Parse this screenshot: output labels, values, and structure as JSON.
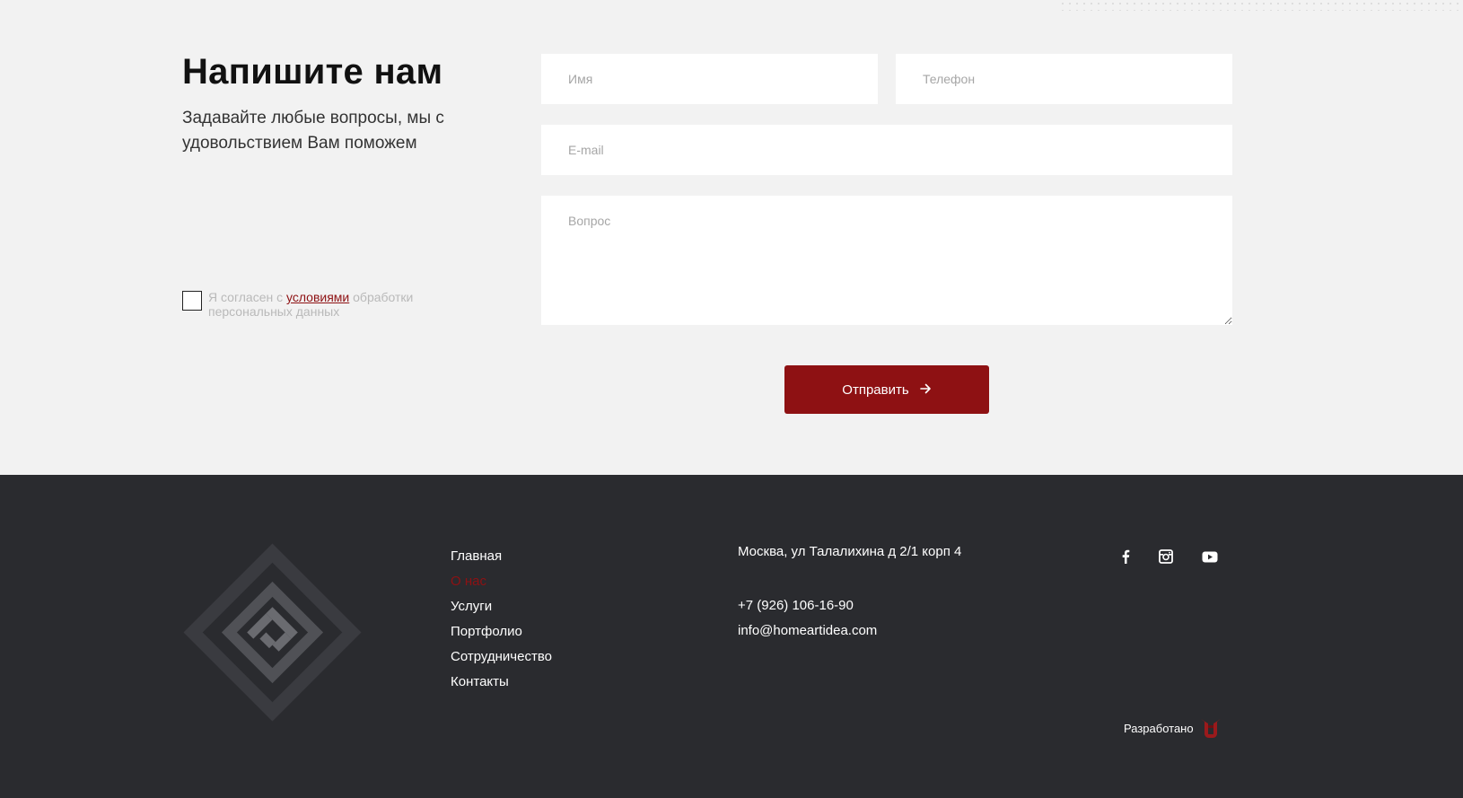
{
  "contact": {
    "heading": "Напишите нам",
    "subtext": "Задавайте любые вопросы, мы с удовольствием Вам поможем",
    "consent": {
      "prefix": "Я согласен с ",
      "link": "условиями",
      "suffix": " обработки персональных данных"
    },
    "form": {
      "name_placeholder": "Имя",
      "phone_placeholder": "Телефон",
      "email_placeholder": "E-mail",
      "question_placeholder": "Вопрос",
      "submit_label": "Отправить",
      "submit_icon": "arrow-right-icon"
    }
  },
  "footer": {
    "logo": "homeartidea-logo",
    "nav": [
      {
        "label": "Главная"
      },
      {
        "label": "О нас"
      },
      {
        "label": "Услуги"
      },
      {
        "label": "Портфолио"
      },
      {
        "label": "Сотрудничество"
      },
      {
        "label": "Контакты"
      }
    ],
    "active_nav_index": 1,
    "address": "Москва, ул Талалихина д 2/1 корп 4",
    "phone": "+7 (926) 106-16-90",
    "email": "info@homeartidea.com",
    "social": [
      "facebook-icon",
      "instagram-icon",
      "youtube-icon"
    ],
    "developed_by": "Разработано",
    "developer_logo": "developer-logo"
  },
  "colors": {
    "accent": "#8e1113",
    "background": "#f2f2f2",
    "footer_bg": "#2a2b2f",
    "input_bg": "#ffffff",
    "muted_text": "#b9b9b9"
  }
}
